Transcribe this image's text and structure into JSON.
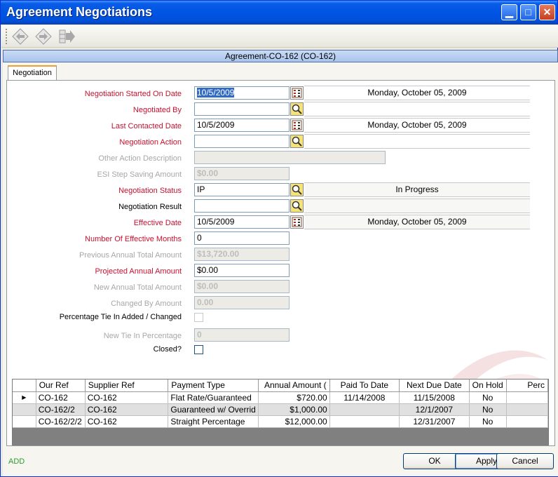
{
  "window": {
    "title": "Agreement Negotiations"
  },
  "header_bar": {
    "text": "Agreement-CO-162 (CO-162)"
  },
  "tabs": [
    {
      "label": "Negotiation"
    }
  ],
  "form": {
    "negotiation_started": {
      "label": "Negotiation Started On Date",
      "value": "10/5/2009",
      "display": "Monday, October 05, 2009"
    },
    "negotiated_by": {
      "label": "Negotiated By",
      "value": ""
    },
    "last_contacted": {
      "label": "Last Contacted Date",
      "value": "10/5/2009",
      "display": "Monday, October 05, 2009"
    },
    "negotiation_action": {
      "label": "Negotiation Action",
      "value": ""
    },
    "other_action": {
      "label": "Other Action Description",
      "value": ""
    },
    "esi_step": {
      "label": "ESI Step Saving Amount",
      "value": "$0.00"
    },
    "negotiation_status": {
      "label": "Negotiation Status",
      "value": "IP",
      "display": "In Progress"
    },
    "negotiation_result": {
      "label": "Negotiation Result",
      "value": ""
    },
    "effective_date": {
      "label": "Effective Date",
      "value": "10/5/2009",
      "display": "Monday, October 05, 2009"
    },
    "effective_months": {
      "label": "Number Of Effective Months",
      "value": "0"
    },
    "prev_annual": {
      "label": "Previous Annual Total Amount",
      "value": "$13,720.00"
    },
    "projected_annual": {
      "label": "Projected Annual Amount",
      "value": "$0.00"
    },
    "new_annual": {
      "label": "New Annual Total Amount",
      "value": "$0.00"
    },
    "changed_by": {
      "label": "Changed By Amount",
      "value": "0.00"
    },
    "pct_tie_added": {
      "label": "Percentage Tie In Added / Changed"
    },
    "new_tie": {
      "label": "New Tie In Percentage",
      "value": "0"
    },
    "closed": {
      "label": "Closed?"
    }
  },
  "grid": {
    "columns": [
      "Our Ref",
      "Supplier Ref",
      "Payment Type",
      "Annual Amount (",
      "Paid To Date",
      "Next Due Date",
      "On Hold",
      "Perc"
    ],
    "rows": [
      [
        "CO-162",
        "CO-162",
        "Flat Rate/Guaranteed",
        "$720.00",
        "11/14/2008",
        "11/15/2008",
        "No",
        ""
      ],
      [
        "CO-162/2",
        "CO-162",
        "Guaranteed w/ Overrid",
        "$1,000.00",
        "",
        "12/1/2007",
        "No",
        ""
      ],
      [
        "CO-162/2/2",
        "CO-162",
        "Straight Percentage",
        "$12,000.00",
        "",
        "12/31/2007",
        "No",
        ""
      ]
    ]
  },
  "status_text": "ADD",
  "buttons": {
    "ok": "OK",
    "apply": "Apply",
    "cancel": "Cancel"
  },
  "colors": {
    "required": "#c8102e",
    "disabled": "#a7a7a7",
    "status": "#2e9a2e"
  }
}
